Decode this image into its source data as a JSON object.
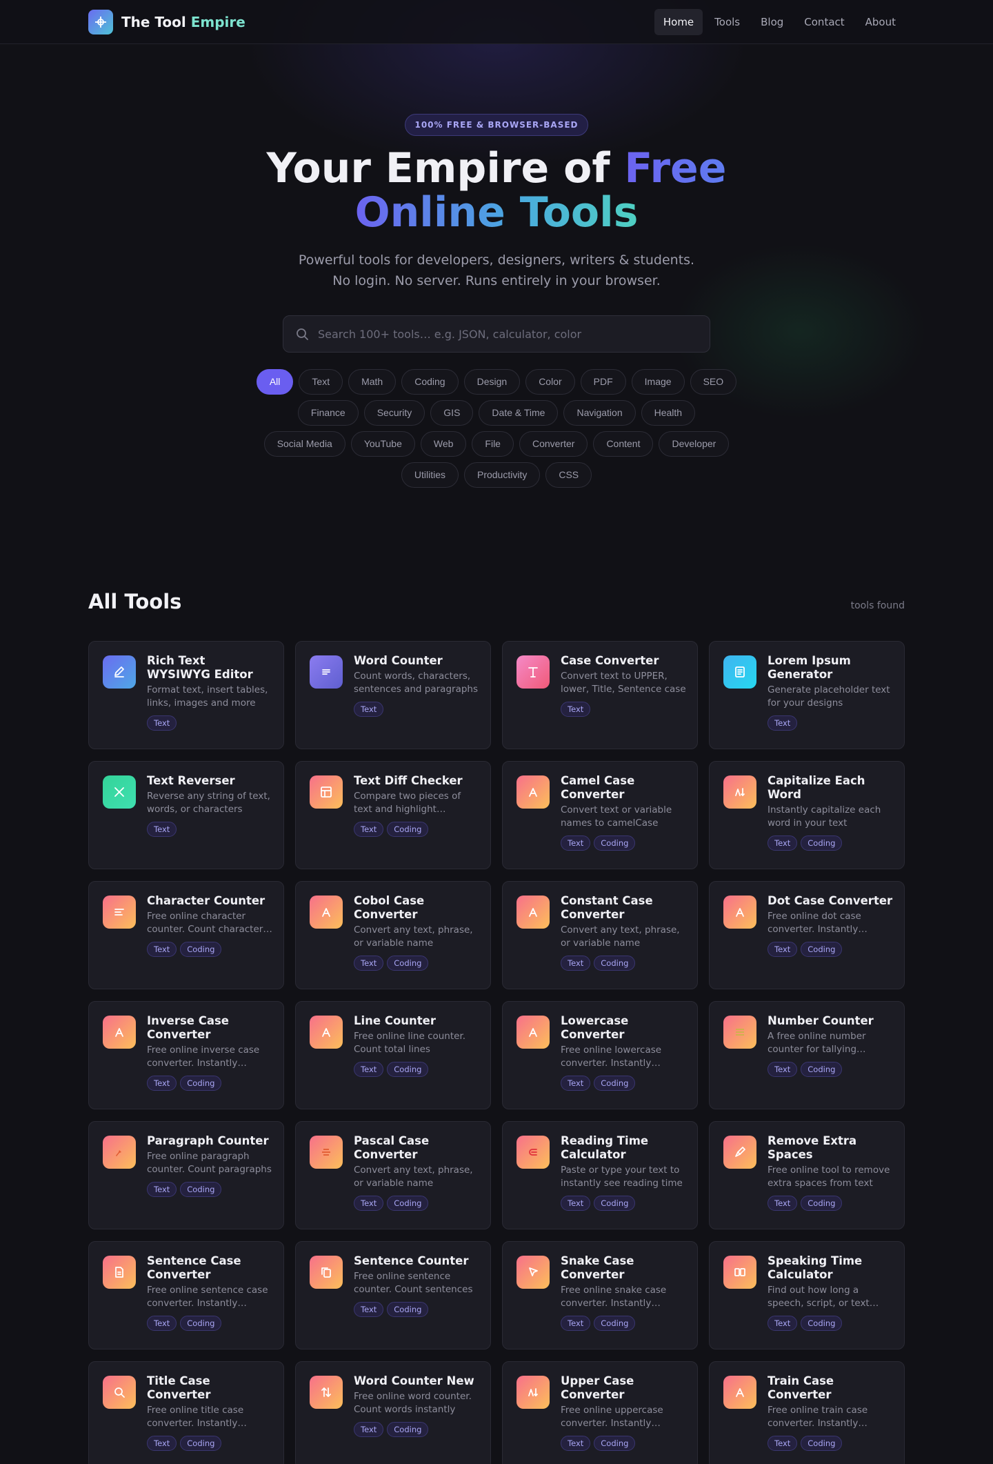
{
  "brand": {
    "name_main": "The Tool",
    "name_accent": "Empire"
  },
  "nav": [
    {
      "label": "Home",
      "active": true
    },
    {
      "label": "Tools"
    },
    {
      "label": "Blog"
    },
    {
      "label": "Contact"
    },
    {
      "label": "About"
    }
  ],
  "hero": {
    "badge": "100% FREE & BROWSER-BASED",
    "title_part1": "Your Empire of ",
    "title_part2": "Free",
    "title_line2": "Online Tools",
    "subtitle_line1": "Powerful tools for developers, designers, writers & students.",
    "subtitle_line2": "No login. No server. Runs entirely in your browser."
  },
  "search": {
    "placeholder": "Search 100+ tools… e.g. JSON, calculator, color",
    "value": ""
  },
  "categories": [
    [
      "All",
      "Text",
      "Math",
      "Coding",
      "Design",
      "Color",
      "PDF",
      "Image",
      "SEO"
    ],
    [
      "Finance",
      "Security",
      "GIS",
      "Date & Time",
      "Navigation",
      "Health"
    ],
    [
      "Social Media",
      "YouTube",
      "Web",
      "File",
      "Converter",
      "Content",
      "Developer"
    ],
    [
      "Utilities",
      "Productivity",
      "CSS"
    ]
  ],
  "active_category": "All",
  "tools_section": {
    "title": "All Tools",
    "count_text": "tools found"
  },
  "tools": [
    {
      "title": "Rich Text WYSIWYG Editor",
      "desc": "Format text, insert tables, links, images and more",
      "tags": [
        "Text"
      ],
      "icon": "pencil-icon",
      "color": "g-blue"
    },
    {
      "title": "Word Counter",
      "desc": "Count words, characters, sentences and paragraphs",
      "tags": [
        "Text"
      ],
      "icon": "lines-icon",
      "color": "g-violet"
    },
    {
      "title": "Case Converter",
      "desc": "Convert text to UPPER, lower, Title, Sentence case",
      "tags": [
        "Text"
      ],
      "icon": "type-icon",
      "color": "g-pink"
    },
    {
      "title": "Lorem Ipsum Generator",
      "desc": "Generate placeholder text for your designs",
      "tags": [
        "Text"
      ],
      "icon": "document-icon",
      "color": "g-cyan"
    },
    {
      "title": "Text Reverser",
      "desc": "Reverse any string of text, words, or characters",
      "tags": [
        "Text"
      ],
      "icon": "cross-icon",
      "color": "g-green"
    },
    {
      "title": "Text Diff Checker",
      "desc": "Compare two pieces of text and highlight differences",
      "tags": [
        "Text",
        "Coding"
      ],
      "icon": "table-icon",
      "color": "g-warm"
    },
    {
      "title": "Camel Case Converter",
      "desc": "Convert text or variable names to camelCase",
      "tags": [
        "Text",
        "Coding"
      ],
      "icon": "letter-a-icon",
      "color": "g-warm"
    },
    {
      "title": "Capitalize Each Word",
      "desc": "Instantly capitalize each word in your text",
      "tags": [
        "Text",
        "Coding"
      ],
      "icon": "sort-icon",
      "color": "g-warm"
    },
    {
      "title": "Character Counter",
      "desc": "Free online character counter. Count characters instantly",
      "tags": [
        "Text",
        "Coding"
      ],
      "icon": "align-icon",
      "color": "g-warm"
    },
    {
      "title": "Cobol Case Converter",
      "desc": "Convert any text, phrase, or variable name",
      "tags": [
        "Text",
        "Coding"
      ],
      "icon": "letter-a-icon",
      "color": "g-warm"
    },
    {
      "title": "Constant Case Converter",
      "desc": "Convert any text, phrase, or variable name",
      "tags": [
        "Text",
        "Coding"
      ],
      "icon": "letter-a-icon",
      "color": "g-warm"
    },
    {
      "title": "Dot Case Converter",
      "desc": "Free online dot case converter. Instantly convert",
      "tags": [
        "Text",
        "Coding"
      ],
      "icon": "letter-a-icon",
      "color": "g-warm"
    },
    {
      "title": "Inverse Case Converter",
      "desc": "Free online inverse case converter. Instantly convert",
      "tags": [
        "Text",
        "Coding"
      ],
      "icon": "letter-a-icon",
      "color": "g-warm"
    },
    {
      "title": "Line Counter",
      "desc": "Free online line counter. Count total lines",
      "tags": [
        "Text",
        "Coding"
      ],
      "icon": "letter-a-icon",
      "color": "g-warm"
    },
    {
      "title": "Lowercase Converter",
      "desc": "Free online lowercase converter. Instantly convert",
      "tags": [
        "Text",
        "Coding"
      ],
      "icon": "letter-a-icon",
      "color": "g-warm"
    },
    {
      "title": "Number Counter",
      "desc": "A free online number counter for tallying numbers",
      "tags": [
        "Text",
        "Coding"
      ],
      "icon": "list-icon",
      "color": "g-warm"
    },
    {
      "title": "Paragraph Counter",
      "desc": "Free online paragraph counter. Count paragraphs",
      "tags": [
        "Text",
        "Coding"
      ],
      "icon": "pin-icon",
      "color": "g-warm"
    },
    {
      "title": "Pascal Case Converter",
      "desc": "Convert any text, phrase, or variable name",
      "tags": [
        "Text",
        "Coding"
      ],
      "icon": "strike-icon",
      "color": "g-warm"
    },
    {
      "title": "Reading Time Calculator",
      "desc": "Paste or type your text to instantly see reading time",
      "tags": [
        "Text",
        "Coding"
      ],
      "icon": "epsilon-icon",
      "color": "g-warm"
    },
    {
      "title": "Remove Extra Spaces",
      "desc": "Free online tool to remove extra spaces from text",
      "tags": [
        "Text",
        "Coding"
      ],
      "icon": "brush-icon",
      "color": "g-warm"
    },
    {
      "title": "Sentence Case Converter",
      "desc": "Free online sentence case converter. Instantly convert",
      "tags": [
        "Text",
        "Coding"
      ],
      "icon": "file-text-icon",
      "color": "g-warm"
    },
    {
      "title": "Sentence Counter",
      "desc": "Free online sentence counter. Count sentences",
      "tags": [
        "Text",
        "Coding"
      ],
      "icon": "copy-icon",
      "color": "g-warm"
    },
    {
      "title": "Snake Case Converter",
      "desc": "Free online snake case converter. Instantly convert",
      "tags": [
        "Text",
        "Coding"
      ],
      "icon": "cursor-icon",
      "color": "g-warm"
    },
    {
      "title": "Speaking Time Calculator",
      "desc": "Find out how long a speech, script, or text takes",
      "tags": [
        "Text",
        "Coding"
      ],
      "icon": "columns-icon",
      "color": "g-warm"
    },
    {
      "title": "Title Case Converter",
      "desc": "Free online title case converter. Instantly convert",
      "tags": [
        "Text",
        "Coding"
      ],
      "icon": "zoom-icon",
      "color": "g-warm"
    },
    {
      "title": "Word Counter New",
      "desc": "Free online word counter. Count words instantly",
      "tags": [
        "Text",
        "Coding"
      ],
      "icon": "arrows-updown-icon",
      "color": "g-warm"
    },
    {
      "title": "Upper Case Converter",
      "desc": "Free online uppercase converter. Instantly convert",
      "tags": [
        "Text",
        "Coding"
      ],
      "icon": "sort-icon",
      "color": "g-warm"
    },
    {
      "title": "Train Case Converter",
      "desc": "Free online train case converter. Instantly convert",
      "tags": [
        "Text",
        "Coding"
      ],
      "icon": "letter-a-icon",
      "color": "g-warm"
    }
  ]
}
